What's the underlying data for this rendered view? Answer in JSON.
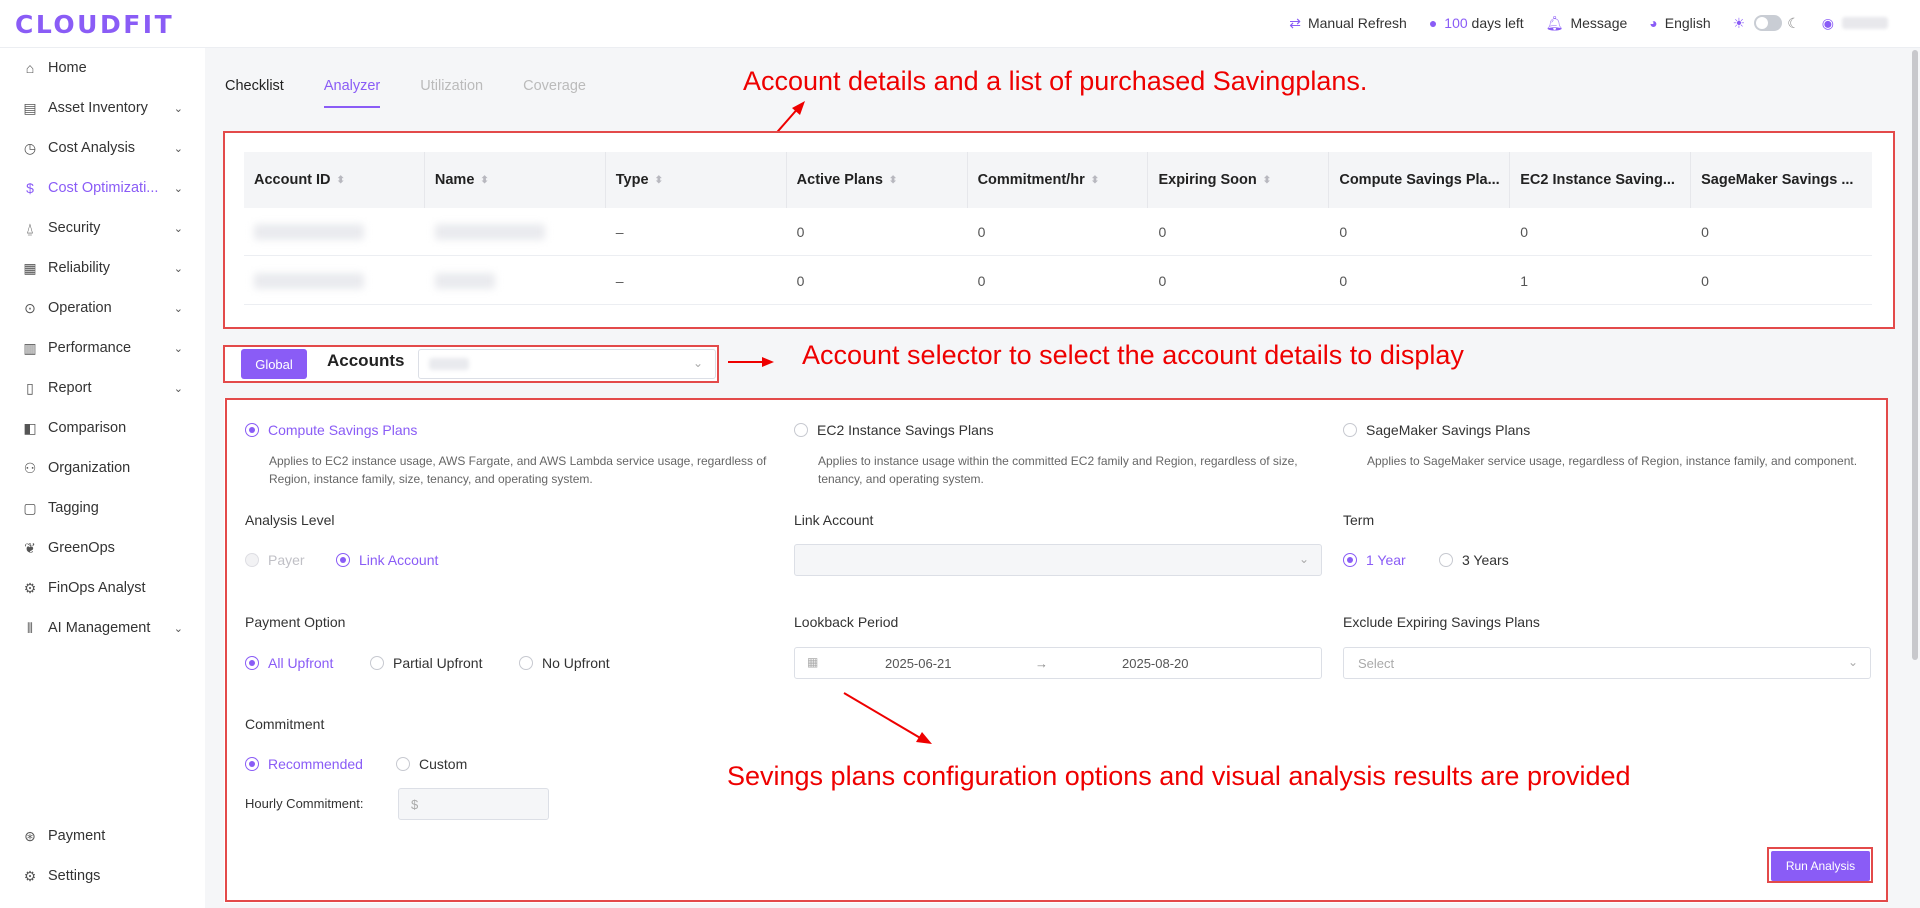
{
  "header": {
    "logo": "CLOUDFIT",
    "manual_refresh": "Manual Refresh",
    "days_count": "100",
    "days_left": "days left",
    "message": "Message",
    "language": "English"
  },
  "sidebar": {
    "items": [
      {
        "label": "Home",
        "icon": "home-icon"
      },
      {
        "label": "Asset Inventory",
        "icon": "inventory-icon"
      },
      {
        "label": "Cost Analysis",
        "icon": "clock-icon"
      },
      {
        "label": "Cost Optimizati...",
        "icon": "dollar-icon"
      },
      {
        "label": "Security",
        "icon": "alarm-icon"
      },
      {
        "label": "Reliability",
        "icon": "reliability-icon"
      },
      {
        "label": "Operation",
        "icon": "operation-icon"
      },
      {
        "label": "Performance",
        "icon": "performance-icon"
      },
      {
        "label": "Report",
        "icon": "report-icon"
      },
      {
        "label": "Comparison",
        "icon": "comparison-icon"
      },
      {
        "label": "Organization",
        "icon": "organization-icon"
      },
      {
        "label": "Tagging",
        "icon": "tag-icon"
      },
      {
        "label": "GreenOps",
        "icon": "leaf-icon"
      },
      {
        "label": "FinOps Analyst",
        "icon": "analyst-icon"
      },
      {
        "label": "AI Management",
        "icon": "ai-icon"
      }
    ],
    "payment": "Payment",
    "settings": "Settings"
  },
  "tabs": [
    "Checklist",
    "Analyzer",
    "Utilization",
    "Coverage"
  ],
  "table": {
    "columns": [
      "Account ID",
      "Name",
      "Type",
      "Active Plans",
      "Commitment/hr",
      "Expiring Soon",
      "Compute Savings Pla...",
      "EC2 Instance Saving...",
      "SageMaker Savings ..."
    ],
    "rows": [
      [
        "–",
        "0",
        "0",
        "0",
        "0",
        "0",
        "0"
      ],
      [
        "–",
        "0",
        "0",
        "0",
        "0",
        "1",
        "0"
      ]
    ]
  },
  "selector": {
    "global": "Global",
    "accounts": "Accounts"
  },
  "plans": [
    {
      "label": "Compute Savings Plans",
      "desc": "Applies to EC2 instance usage, AWS Fargate, and AWS Lambda service usage, regardless of Region, instance family, size, tenancy, and operating system."
    },
    {
      "label": "EC2 Instance Savings Plans",
      "desc": "Applies to instance usage within the committed EC2 family and Region, regardless of size, tenancy, and operating system."
    },
    {
      "label": "SageMaker Savings Plans",
      "desc": "Applies to SageMaker service usage, regardless of Region, instance family, and component."
    }
  ],
  "config": {
    "analysis_level": "Analysis Level",
    "payer": "Payer",
    "link_account_opt": "Link Account",
    "link_account": "Link Account",
    "term": "Term",
    "year1": "1 Year",
    "year3": "3 Years",
    "payment_option": "Payment Option",
    "all_upfront": "All Upfront",
    "partial_upfront": "Partial Upfront",
    "no_upfront": "No Upfront",
    "lookback": "Lookback Period",
    "date_start": "2025-06-21",
    "date_end": "2025-08-20",
    "exclude": "Exclude Expiring Savings Plans",
    "select_ph": "Select",
    "commitment": "Commitment",
    "recommended": "Recommended",
    "custom": "Custom",
    "hourly": "Hourly Commitment:",
    "dollar_ph": "$",
    "run": "Run Analysis"
  },
  "annotations": {
    "a1": "Account details and a list of purchased Savingplans.",
    "a2": "Account selector to select the account details to display",
    "a3": "Sevings plans configuration options and visual analysis results are provided"
  },
  "colors": {
    "accent": "#8a5cf6",
    "annotation": "#e00000"
  }
}
